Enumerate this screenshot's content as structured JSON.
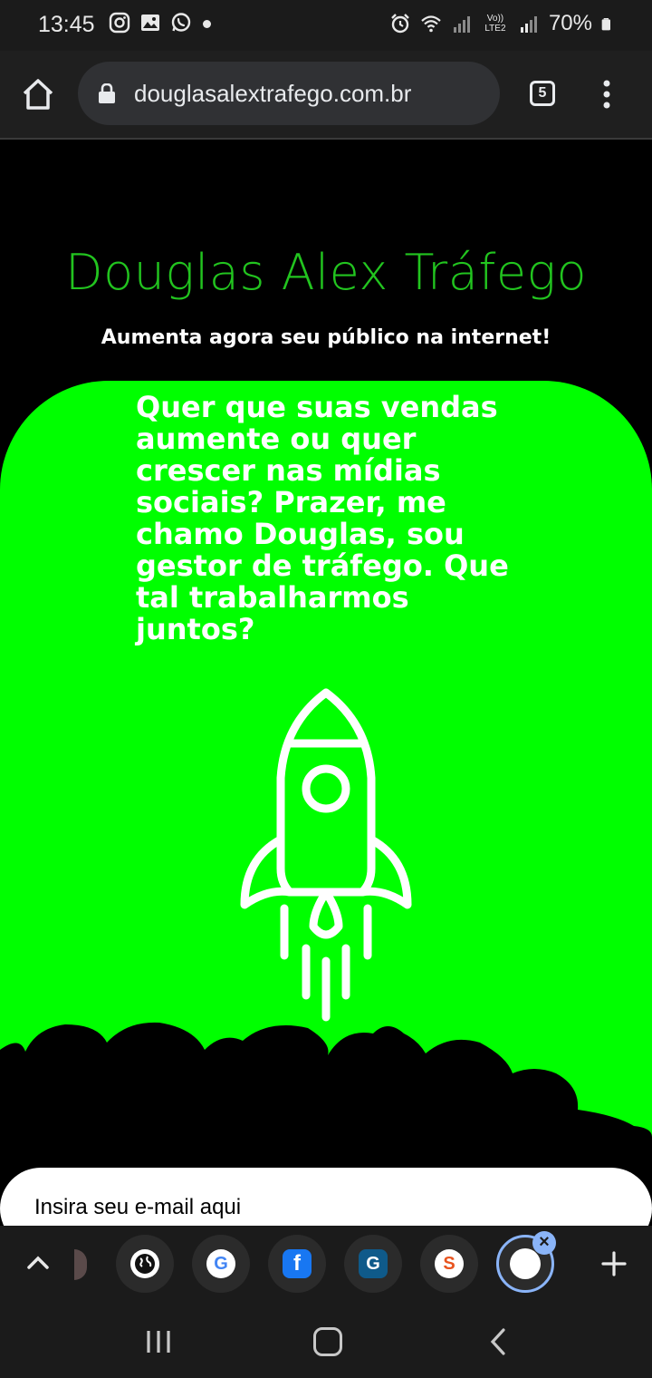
{
  "status_bar": {
    "time": "13:45",
    "left_icons": [
      "instagram-icon",
      "gallery-icon",
      "whatsapp-icon",
      "notification-dot"
    ],
    "right_icons": [
      "alarm-icon",
      "wifi-icon",
      "signal-icon",
      "volte-icon",
      "signal-icon"
    ],
    "volte_label": "Vo)) LTE2",
    "battery": "70%"
  },
  "browser": {
    "url": "douglasalextrafego.com.br",
    "tab_count": "5"
  },
  "page": {
    "title": "Douglas Alex Tráfego",
    "subtitle": "Aumenta agora seu público na internet!",
    "hero_text": "Quer que suas vendas aumente ou quer crescer nas mídias sociais? Prazer, me chamo Douglas, sou gestor de tráfego. Que tal trabalharmos juntos?",
    "email_placeholder": "Insira seu e-mail aqui"
  },
  "tab_strip": {
    "tabs": [
      {
        "icon": "globe-icon",
        "letter": ""
      },
      {
        "icon": "google-icon",
        "letter": "G"
      },
      {
        "icon": "facebook-icon",
        "letter": "f"
      },
      {
        "icon": "g-logo-icon",
        "letter": "G"
      },
      {
        "icon": "s-logo-icon",
        "letter": "S"
      },
      {
        "icon": "blank-page-icon",
        "letter": ""
      }
    ],
    "close_label": "×",
    "add_label": "+"
  },
  "colors": {
    "accent_green": "#00ff00",
    "title_green": "#22c41f",
    "background": "#000000"
  }
}
